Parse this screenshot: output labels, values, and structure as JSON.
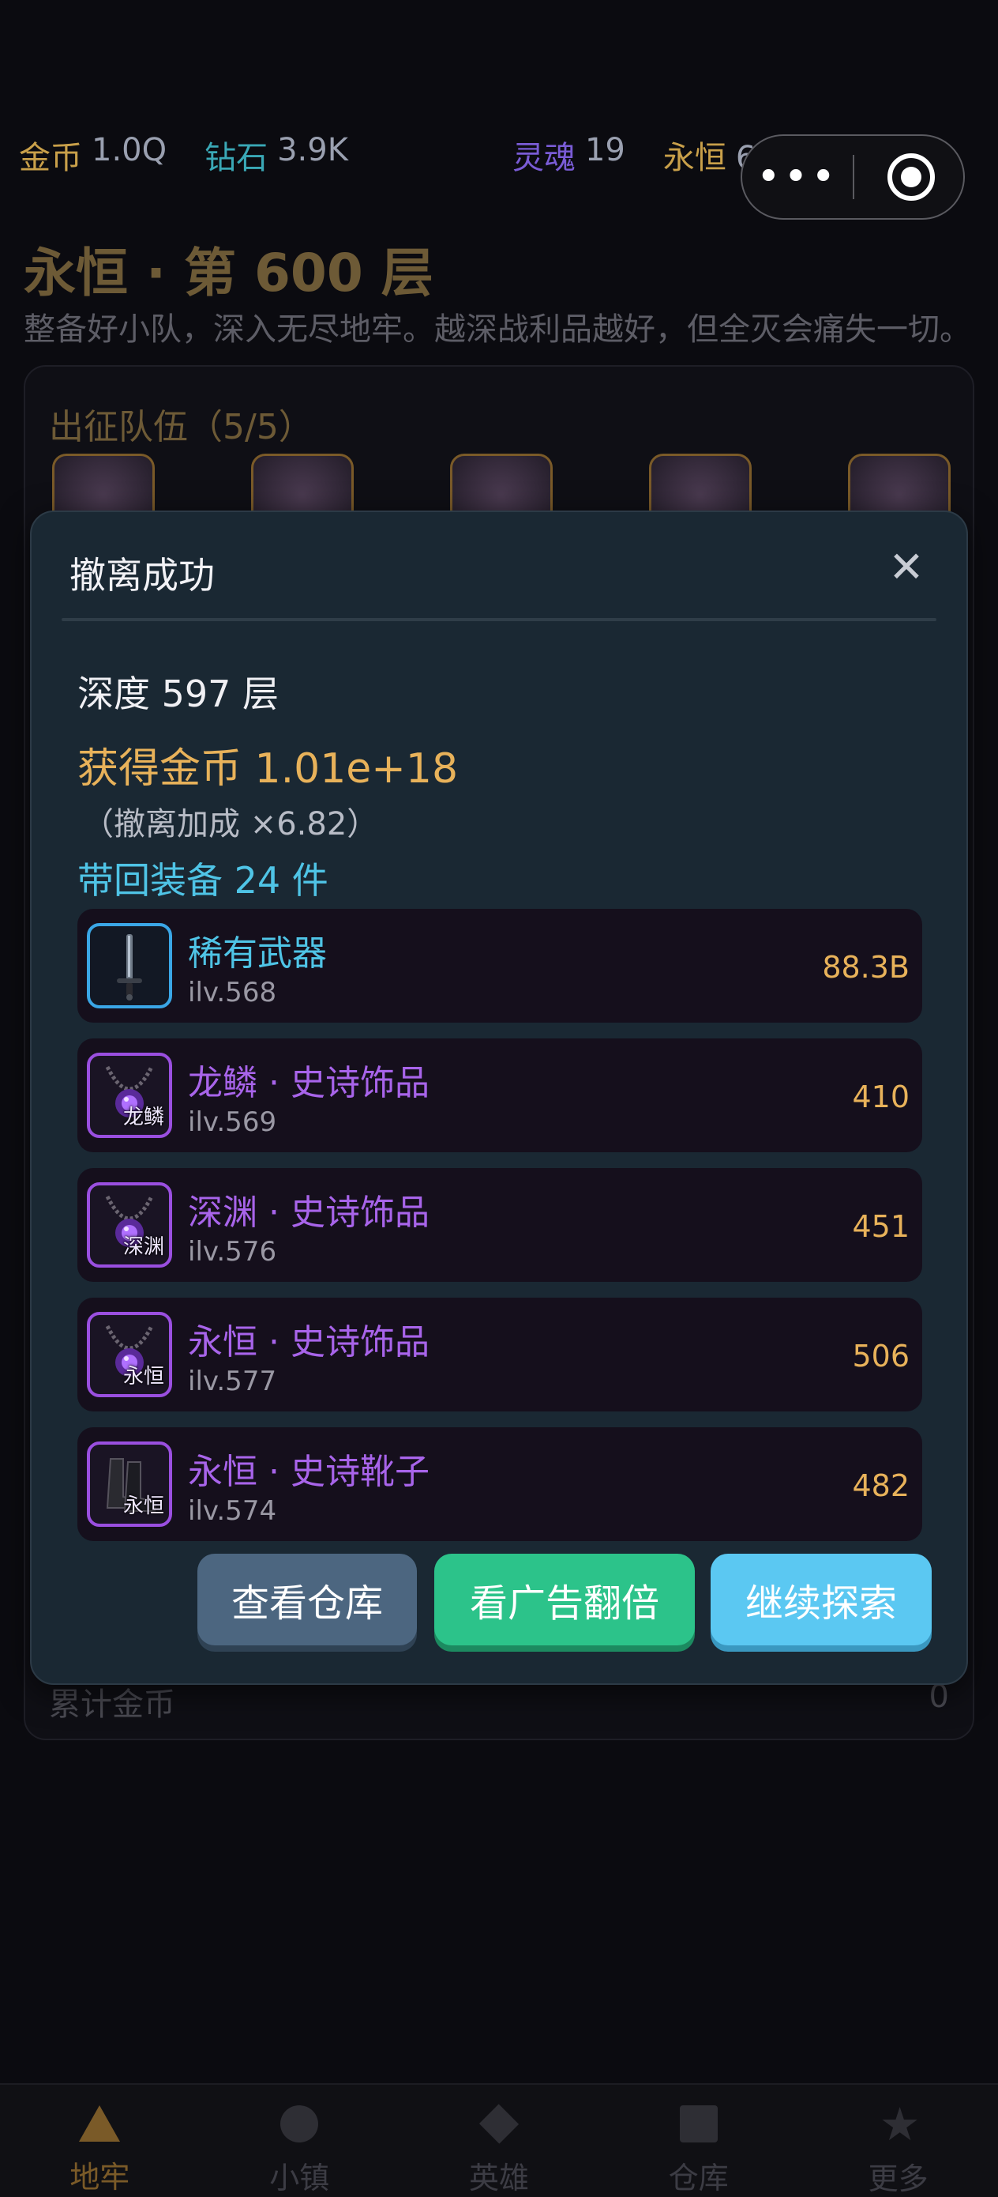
{
  "resources": {
    "gold_label": "金币",
    "gold_value": "1.0Q",
    "diamond_label": "钻石",
    "diamond_value": "3.9K",
    "soul_label": "灵魂",
    "soul_value": "19",
    "eternal_label": "永恒",
    "eternal_value": "670层"
  },
  "capsule": {
    "more": "•••"
  },
  "page": {
    "title": "永恒 · 第 600 层",
    "subtitle": "整备好小队，深入无尽地牢。越深战利品越好，但全灭会痛失一切。"
  },
  "team": {
    "title": "出征队伍（5/5）",
    "cumulative_label": "累计金币",
    "cumulative_value": "0"
  },
  "modal": {
    "title": "撤离成功",
    "close": "✕",
    "depth": "深度 597 层",
    "gold": "获得金币 1.01e+18",
    "bonus": "（撤离加成 ×6.82）",
    "equip_count": "带回装备 24 件",
    "items": [
      {
        "name": "稀有武器",
        "ilv": "ilv.568",
        "value": "88.3B",
        "rarity": "rare",
        "tag": "",
        "icon": "sword-icon"
      },
      {
        "name": "龙鳞 · 史诗饰品",
        "ilv": "ilv.569",
        "value": "410",
        "rarity": "epic",
        "tag": "龙鳞",
        "icon": "necklace-icon"
      },
      {
        "name": "深渊 · 史诗饰品",
        "ilv": "ilv.576",
        "value": "451",
        "rarity": "epic",
        "tag": "深渊",
        "icon": "necklace-icon"
      },
      {
        "name": "永恒 · 史诗饰品",
        "ilv": "ilv.577",
        "value": "506",
        "rarity": "epic",
        "tag": "永恒",
        "icon": "necklace-icon"
      },
      {
        "name": "永恒 · 史诗靴子",
        "ilv": "ilv.574",
        "value": "482",
        "rarity": "epic",
        "tag": "永恒",
        "icon": "boots-icon"
      }
    ],
    "buttons": {
      "warehouse": "查看仓库",
      "ad_double": "看广告翻倍",
      "continue": "继续探索"
    }
  },
  "nav": {
    "items": [
      {
        "label": "地牢",
        "icon": "triangle-icon",
        "active": true
      },
      {
        "label": "小镇",
        "icon": "circle-icon",
        "active": false
      },
      {
        "label": "英雄",
        "icon": "diamond-icon",
        "active": false
      },
      {
        "label": "仓库",
        "icon": "square-icon",
        "active": false
      },
      {
        "label": "更多",
        "icon": "star-icon",
        "active": false
      }
    ]
  },
  "colors": {
    "accent_gold": "#e8b25a",
    "epic_purple": "#a864ea",
    "rare_blue": "#4fc4e6",
    "ad_green": "#2cc38a"
  }
}
